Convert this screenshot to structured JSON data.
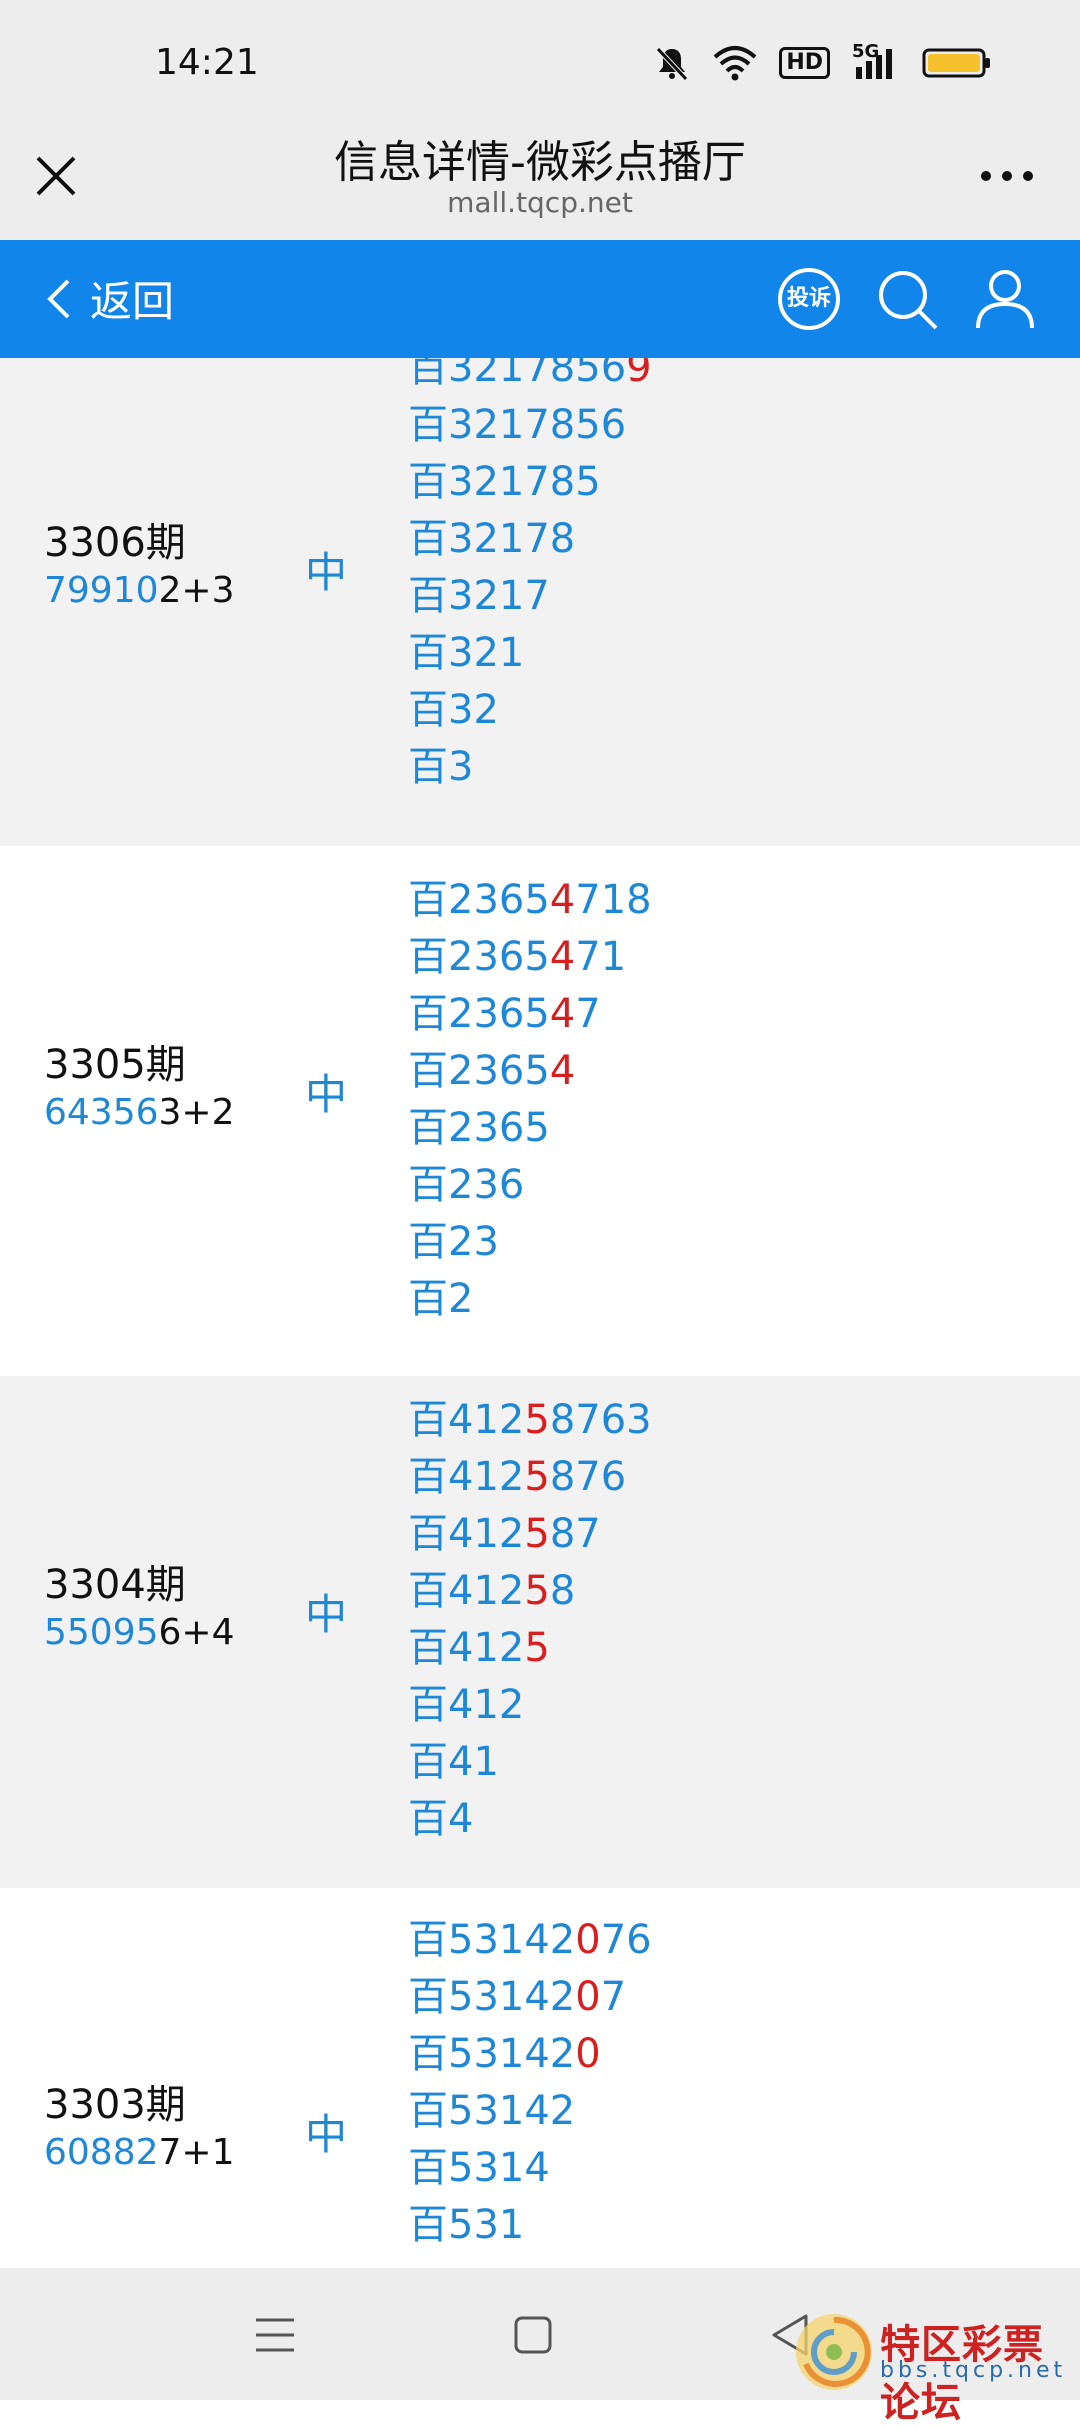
{
  "status": {
    "time": "14:21",
    "hd_label": "HD",
    "net_label": "5G"
  },
  "browser": {
    "title": "信息详情-微彩点播厅",
    "url": "mall.tqcp.net"
  },
  "toolbar": {
    "back_label": "返回",
    "complaint_label": "投诉"
  },
  "rows": [
    {
      "period": "3306期",
      "draw_highlight": "79910",
      "draw_rest": "2+3",
      "result": "中",
      "lines": [
        {
          "prefix": "百",
          "normal": "3217856",
          "hit": "9",
          "tail": ""
        },
        {
          "prefix": "百",
          "normal": "3217856",
          "hit": "",
          "tail": ""
        },
        {
          "prefix": "百",
          "normal": "321785",
          "hit": "",
          "tail": ""
        },
        {
          "prefix": "百",
          "normal": "32178",
          "hit": "",
          "tail": ""
        },
        {
          "prefix": "百",
          "normal": "3217",
          "hit": "",
          "tail": ""
        },
        {
          "prefix": "百",
          "normal": "321",
          "hit": "",
          "tail": ""
        },
        {
          "prefix": "百",
          "normal": "32",
          "hit": "",
          "tail": ""
        },
        {
          "prefix": "百",
          "normal": "3",
          "hit": "",
          "tail": ""
        }
      ]
    },
    {
      "period": "3305期",
      "draw_highlight": "64356",
      "draw_rest": "3+2",
      "result": "中",
      "lines": [
        {
          "prefix": "百",
          "normal": "2365",
          "hit": "4",
          "tail": "718"
        },
        {
          "prefix": "百",
          "normal": "2365",
          "hit": "4",
          "tail": "71"
        },
        {
          "prefix": "百",
          "normal": "2365",
          "hit": "4",
          "tail": "7"
        },
        {
          "prefix": "百",
          "normal": "2365",
          "hit": "4",
          "tail": ""
        },
        {
          "prefix": "百",
          "normal": "2365",
          "hit": "",
          "tail": ""
        },
        {
          "prefix": "百",
          "normal": "236",
          "hit": "",
          "tail": ""
        },
        {
          "prefix": "百",
          "normal": "23",
          "hit": "",
          "tail": ""
        },
        {
          "prefix": "百",
          "normal": "2",
          "hit": "",
          "tail": ""
        }
      ]
    },
    {
      "period": "3304期",
      "draw_highlight": "55095",
      "draw_rest": "6+4",
      "result": "中",
      "lines": [
        {
          "prefix": "百",
          "normal": "412",
          "hit": "5",
          "tail": "8763"
        },
        {
          "prefix": "百",
          "normal": "412",
          "hit": "5",
          "tail": "876"
        },
        {
          "prefix": "百",
          "normal": "412",
          "hit": "5",
          "tail": "87"
        },
        {
          "prefix": "百",
          "normal": "412",
          "hit": "5",
          "tail": "8"
        },
        {
          "prefix": "百",
          "normal": "412",
          "hit": "5",
          "tail": ""
        },
        {
          "prefix": "百",
          "normal": "412",
          "hit": "",
          "tail": ""
        },
        {
          "prefix": "百",
          "normal": "41",
          "hit": "",
          "tail": ""
        },
        {
          "prefix": "百",
          "normal": "4",
          "hit": "",
          "tail": ""
        }
      ]
    },
    {
      "period": "3303期",
      "draw_highlight": "60882",
      "draw_rest": "7+1",
      "result": "中",
      "lines": [
        {
          "prefix": "百",
          "normal": "53142",
          "hit": "0",
          "tail": "76"
        },
        {
          "prefix": "百",
          "normal": "53142",
          "hit": "0",
          "tail": "7"
        },
        {
          "prefix": "百",
          "normal": "53142",
          "hit": "0",
          "tail": ""
        },
        {
          "prefix": "百",
          "normal": "53142",
          "hit": "",
          "tail": ""
        },
        {
          "prefix": "百",
          "normal": "5314",
          "hit": "",
          "tail": ""
        },
        {
          "prefix": "百",
          "normal": "531",
          "hit": "",
          "tail": ""
        }
      ]
    }
  ],
  "watermark": {
    "title": "特区彩票论坛",
    "subtitle": "bbs.tqcp.net"
  },
  "colors": {
    "accent_blue": "#1185ea",
    "number_blue": "#1e88d6",
    "hit_red": "#d81e1e"
  }
}
